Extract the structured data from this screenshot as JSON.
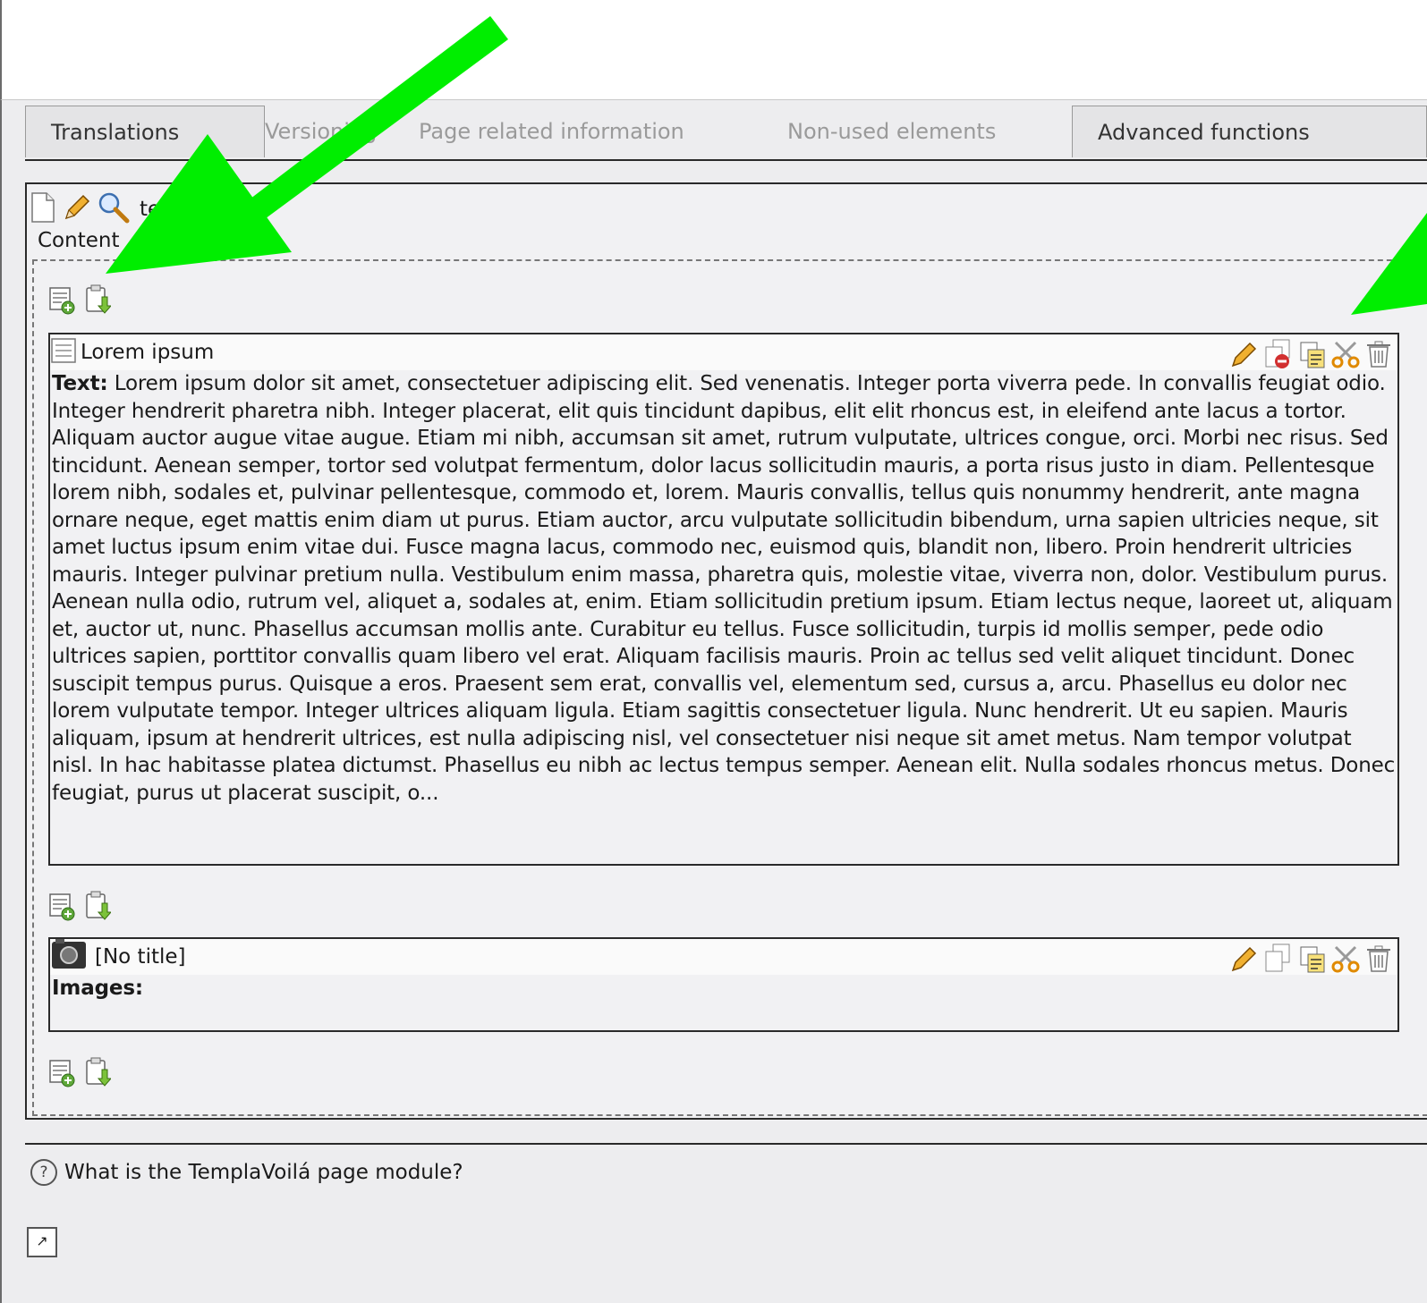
{
  "tabs": [
    {
      "label": "Translations"
    },
    {
      "label": "Versioning"
    },
    {
      "label": "Page related information"
    },
    {
      "label": "Non-used elements"
    },
    {
      "label": "Advanced functions"
    }
  ],
  "page": {
    "title": "template 1"
  },
  "content_area": {
    "label": "Content"
  },
  "elements": [
    {
      "title": "Lorem ipsum",
      "field_label": "Text:",
      "text": "Lorem ipsum dolor sit amet, consectetuer adipiscing elit. Sed venenatis. Integer porta viverra pede. In convallis feugiat odio. Integer hendrerit pharetra nibh. Integer placerat, elit quis tincidunt dapibus, elit elit rhoncus est, in eleifend ante lacus a tortor. Aliquam auctor augue vitae augue. Etiam mi nibh, accumsan sit amet, rutrum vulputate, ultrices congue, orci. Morbi nec risus. Sed tincidunt. Aenean semper, tortor sed volutpat fermentum, dolor lacus sollicitudin mauris, a porta risus justo in diam. Pellentesque lorem nibh, sodales et, pulvinar pellentesque, commodo et, lorem. Mauris convallis, tellus quis nonummy hendrerit, ante magna ornare neque, eget mattis enim diam ut purus. Etiam auctor, arcu vulputate sollicitudin bibendum, urna sapien ultricies neque, sit amet luctus ipsum enim vitae dui. Fusce magna lacus, commodo nec, euismod quis, blandit non, libero. Proin hendrerit ultricies mauris. Integer pulvinar pretium nulla. Vestibulum enim massa, pharetra quis, molestie vitae, viverra non, dolor. Vestibulum purus. Aenean nulla odio, rutrum vel, aliquet a, sodales at, enim. Etiam sollicitudin pretium ipsum. Etiam lectus neque, laoreet ut, aliquam et, auctor ut, nunc. Phasellus accumsan mollis ante. Curabitur eu tellus. Fusce sollicitudin, turpis id mollis semper, pede odio ultrices sapien, porttitor convallis quam libero vel erat. Aliquam facilisis mauris. Proin ac tellus sed velit aliquet tincidunt. Donec suscipit tempus purus. Quisque a eros. Praesent sem erat, convallis vel, elementum sed, cursus a, arcu. Phasellus eu dolor nec lorem vulputate tempor. Integer ultrices aliquam ligula. Etiam sagittis consectetuer ligula. Nunc hendrerit. Ut eu sapien. Mauris aliquam, ipsum at hendrerit ultrices, est nulla adipiscing nisl, vel consectetuer nisi neque sit amet metus. Nam tempor volutpat nisl. In hac habitasse platea dictumst. Phasellus eu nibh ac lectus tempus semper. Aenean elit. Nulla sodales rhoncus metus. Donec feugiat, purus ut placerat suscipit, o..."
    },
    {
      "title": "[No title]",
      "field_label": "Images:",
      "text": ""
    }
  ],
  "help": {
    "text": "What is the TemplaVoilá page module?"
  },
  "colors": {
    "arrow": "#00ee00",
    "icon_green": "#5fa83a",
    "pencil": "#e8a020"
  },
  "icons": [
    "page-icon",
    "pencil-icon",
    "magnifier-icon",
    "new-record-icon",
    "paste-icon",
    "edit-icon",
    "hide-icon",
    "copy-icon",
    "cut-icon",
    "delete-icon",
    "help-icon",
    "popup-icon"
  ]
}
